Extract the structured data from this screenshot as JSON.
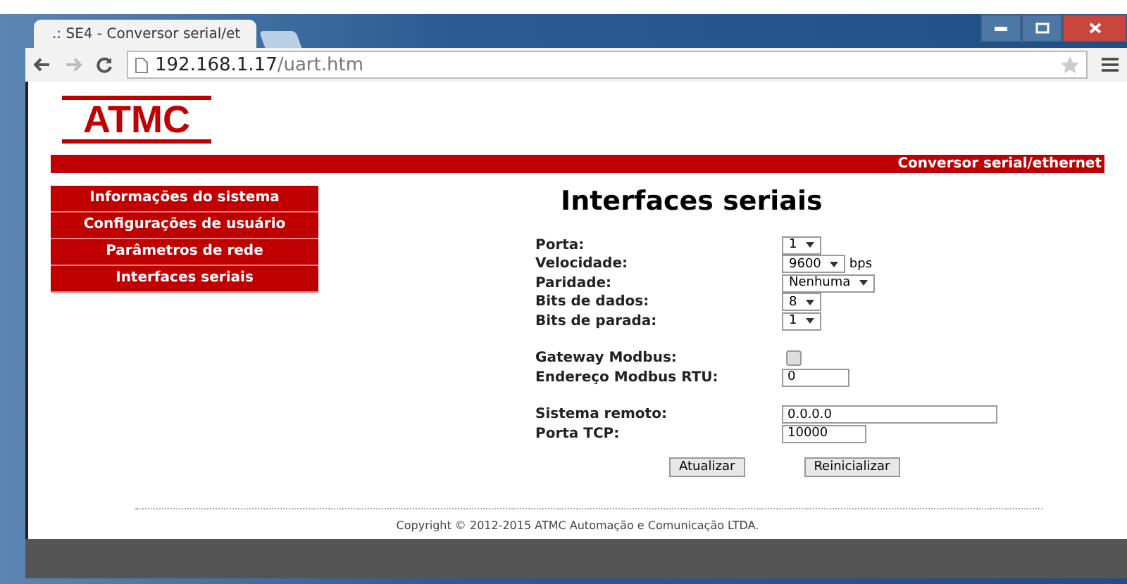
{
  "browser": {
    "tab_title": ".: SE4 - Conversor serial/et",
    "address_host": "192.168.1.17",
    "address_path": "/uart.htm"
  },
  "logo": "ATMC",
  "banner": "Conversor serial/ethernet",
  "menu": [
    {
      "label": "Informações do sistema"
    },
    {
      "label": "Configurações de usuário"
    },
    {
      "label": "Parâmetros de rede"
    },
    {
      "label": "Interfaces seriais"
    }
  ],
  "heading": "Interfaces seriais",
  "groups": [
    [
      {
        "kind": "select",
        "label": "Porta:",
        "value": "1"
      },
      {
        "kind": "select",
        "label": "Velocidade:",
        "value": "9600",
        "unit": "bps"
      },
      {
        "kind": "select",
        "label": "Paridade:",
        "value": "Nenhuma"
      },
      {
        "kind": "select",
        "label": "Bits de dados:",
        "value": "8"
      },
      {
        "kind": "select",
        "label": "Bits de parada:",
        "value": "1"
      }
    ],
    [
      {
        "kind": "checkbox",
        "label": "Gateway Modbus:",
        "checked": false
      },
      {
        "kind": "text",
        "label": "Endereço Modbus RTU:",
        "value": "0"
      }
    ],
    [
      {
        "kind": "text",
        "label": "Sistema remoto:",
        "value": "0.0.0.0"
      },
      {
        "kind": "text",
        "label": "Porta TCP:",
        "value": "10000"
      }
    ]
  ],
  "buttons": [
    "Atualizar",
    "Reinicializar"
  ],
  "footer": "Copyright © 2012-2015 ATMC Automação e Comunicação LTDA."
}
